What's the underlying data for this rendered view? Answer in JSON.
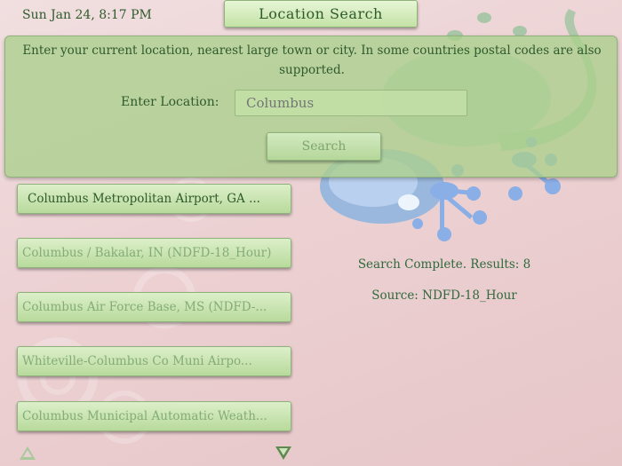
{
  "header": {
    "datetime": "Sun Jan 24, 8:17 PM",
    "title": "Location Search"
  },
  "search_panel": {
    "description": "Enter your current location, nearest large town or city. In some countries postal codes are also supported.",
    "location_label": "Enter Location:",
    "location_placeholder": "Columbus",
    "search_button": "Search"
  },
  "results": [
    {
      "label": "Columbus Metropolitan Airport, GA ..."
    },
    {
      "label": "Columbus / Bakalar, IN (NDFD-18_Hour)"
    },
    {
      "label": "Columbus Air Force Base, MS (NDFD-..."
    },
    {
      "label": "Whiteville-Columbus Co Muni Airpo..."
    },
    {
      "label": "Columbus Municipal Automatic Weath..."
    }
  ],
  "status": {
    "complete": "Search Complete. Results: 8",
    "source": "Source: NDFD-18_Hour"
  },
  "colors": {
    "background": "#ecd1d3",
    "panel": "#abd08c",
    "text": "#2f5a2c",
    "gecko": "#8aaee6"
  },
  "icons": [
    "scroll-up-arrow-icon",
    "scroll-down-arrow-icon",
    "gecko-decoration"
  ]
}
